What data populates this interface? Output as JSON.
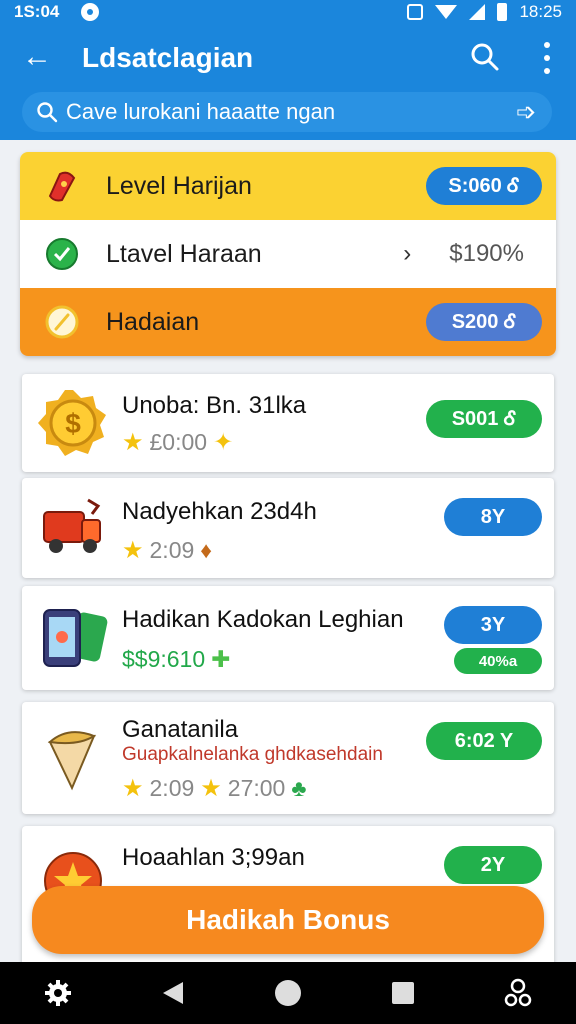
{
  "status_bar": {
    "time_left": "1S:04",
    "time_right": "18:25"
  },
  "app_bar": {
    "back_glyph": "←",
    "title": "Ldsatclagian",
    "search_placeholder": "Cave lurokani haaatte ngan",
    "go_glyph": "➩"
  },
  "levels": [
    {
      "label": "Level Harijan",
      "value": "S:060 Ꮄ",
      "style": "yellow",
      "icon": "chili-icon"
    },
    {
      "label": "Ltavel Haraan",
      "value": "$190%",
      "style": "white",
      "icon": "green-badge-icon"
    },
    {
      "label": "Hadaian",
      "value": "S200 Ꮄ",
      "style": "orange",
      "icon": "pencil-coin-icon"
    }
  ],
  "tasks": [
    {
      "name": "Unoba: Bn. 31lka",
      "meta": "£0:00",
      "reward": "S001 Ꮄ",
      "reward_color": "green",
      "icon": "coin-icon"
    },
    {
      "name": "Nadyehkan 23d4h",
      "meta": "2:09",
      "reward": "8Y",
      "reward_color": "blue",
      "icon": "truck-icon"
    },
    {
      "name": "Hadikan Kadokan Leghian",
      "meta": "$$9:610",
      "reward": "3Y",
      "reward_color": "blue",
      "secondary_reward": "40%a",
      "icon": "tablet-icon"
    },
    {
      "name": "Ganatanila",
      "subtitle": "Guapkalnelanka ghdkasehdain",
      "meta": "2:09",
      "meta2": "27:00",
      "reward": "6:02 Y",
      "reward_color": "green",
      "icon": "cone-icon"
    },
    {
      "name": "Hoaahlan 3;99an",
      "reward": "2Y",
      "reward_color": "green",
      "icon": "star-badge-icon"
    }
  ],
  "bonus_button": "Hadikah Bonus"
}
